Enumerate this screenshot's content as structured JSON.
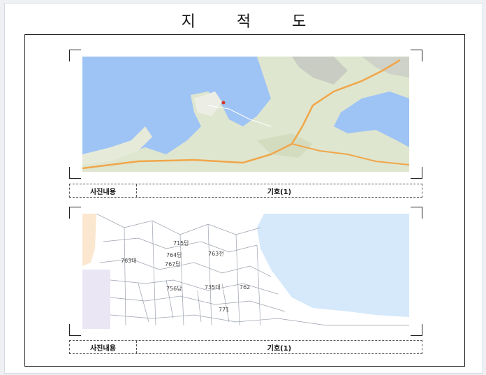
{
  "document": {
    "title": "지 적 도"
  },
  "panels": [
    {
      "caption_label": "사진내용",
      "caption_value": "기호(1)"
    },
    {
      "caption_label": "사진내용",
      "caption_value": "기호(1)",
      "parcel_labels": [
        "715답",
        "764답",
        "763대",
        "767답",
        "763전",
        "756답",
        "735대",
        "762",
        "771"
      ]
    }
  ],
  "colors": {
    "water": "#9ec3f5",
    "land": "#dfe6cf",
    "road": "#f0a64a",
    "sea_cadastral": "#d6e9fb"
  }
}
